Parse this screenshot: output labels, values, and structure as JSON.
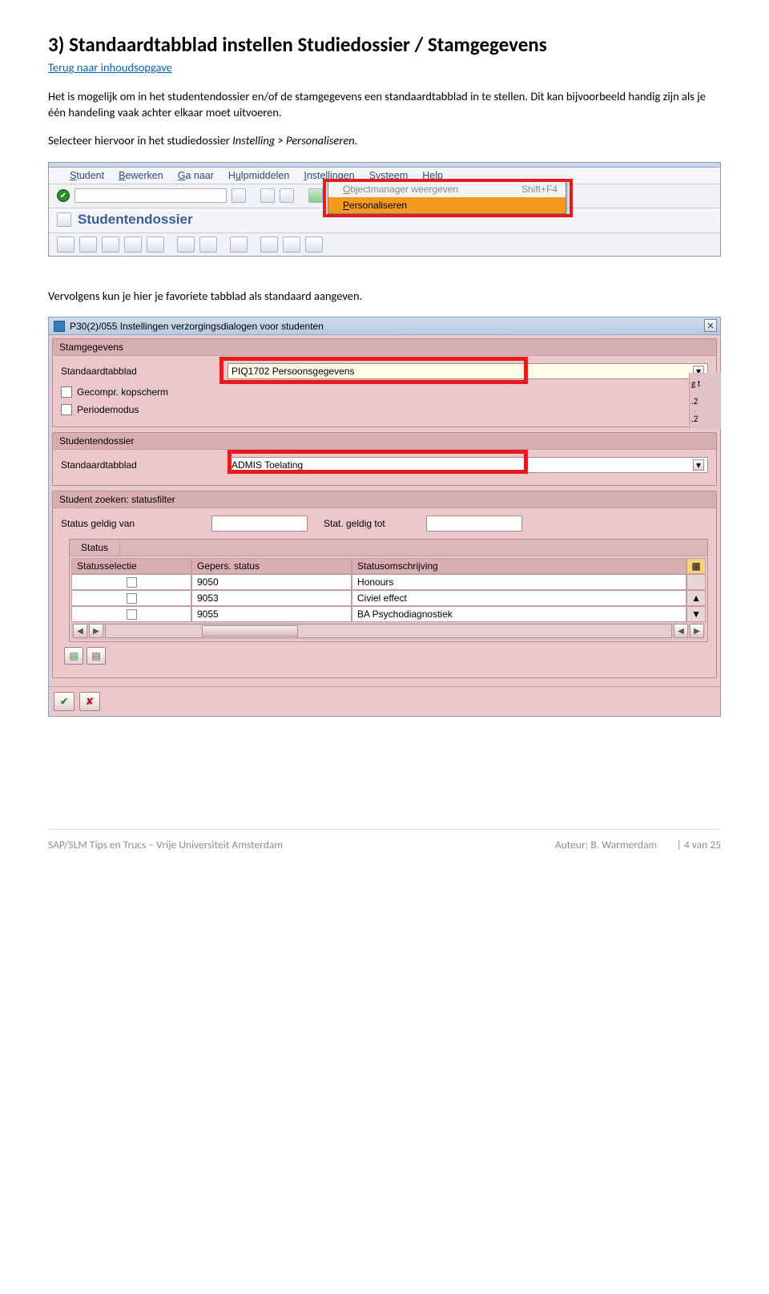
{
  "heading": "3) Standaardtabblad instellen Studiedossier / Stamgegevens",
  "toc_link": "Terug naar inhoudsopgave",
  "para1": "Het is mogelijk om in het studentendossier en/of de stamgegevens een standaardtabblad in te stellen. Dit kan bijvoorbeeld handig zijn als je één handeling vaak achter elkaar moet uitvoeren.",
  "para2_lead": "Selecteer hiervoor in het studiedossier ",
  "para2_italic": "Instelling > Personaliseren.",
  "para3": "Vervolgens kun je hier je favoriete tabblad als standaard aangeven.",
  "shot1": {
    "menu": [
      "Student",
      "Bewerken",
      "Ga naar",
      "Hulpmiddelen",
      "Instellingen",
      "Systeem",
      "Help"
    ],
    "title": "Studentendossier",
    "dd_item1_label": "Objectmanager weergeven",
    "dd_item1_short": "Shift+F4",
    "dd_item2_label": "Personaliseren"
  },
  "shot2": {
    "titlebar": "P30(2)/055 Instellingen verzorgingsdialogen voor studenten",
    "group1_title": "Stamgegevens",
    "g1_label1": "Standaardtabblad",
    "g1_value1": "PIQ1702 Persoonsgegevens",
    "g1_chk1": "Gecompr. kopscherm",
    "g1_chk2": "Periodemodus",
    "group2_title": "Studentendossier",
    "g2_label1": "Standaardtabblad",
    "g2_value1": "ADMIS Toelating",
    "group3_title": "Student zoeken: statusfilter",
    "g3_label_from": "Status geldig van",
    "g3_label_to": "Stat. geldig tot",
    "g3_status_tab": "Status",
    "g3_th1": "Statusselectie",
    "g3_th2": "Gepers. status",
    "g3_th3": "Statusomschrijving",
    "rows": [
      {
        "code": "9050",
        "desc": "Honours"
      },
      {
        "code": "9053",
        "desc": "Civiel effect"
      },
      {
        "code": "9055",
        "desc": "BA Psychodiagnostiek"
      }
    ],
    "side": [
      "g t",
      ".2",
      ".2"
    ]
  },
  "footer_left": "SAP/SLM Tips en Trucs – Vrije Universiteit Amsterdam",
  "footer_mid": "Auteur: B. Warmerdam",
  "footer_right": "| 4 van 25"
}
